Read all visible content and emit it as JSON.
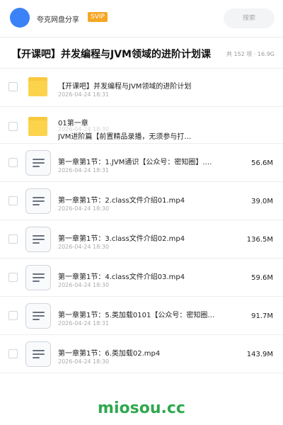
{
  "app": {
    "name": "夸克网盘分享",
    "badge": "SVIP",
    "search_placeholder": "搜索"
  },
  "header": {
    "title": "【开课吧】并发编程与JVM领域的进阶计划课",
    "meta": "共 152 项 · 16.9G"
  },
  "files": [
    {
      "type": "folder",
      "name": "【开课吧】并发编程与JVM领域的进阶计划",
      "date": "2026-04-24 18:31",
      "size": ""
    },
    {
      "type": "folder",
      "name": "01第一章",
      "date": "2026-04-24 18:30",
      "subtitle": "JVM进阶篇【前置精品录播，无须参与打…",
      "size": ""
    },
    {
      "type": "file",
      "name": "第一章第1节：1.JVM通识【公众号：密知圈】.…",
      "date": "2026-04-24 18:31",
      "size": "56.6M"
    },
    {
      "type": "file",
      "name": "第一章第1节：2.class文件介绍01.mp4",
      "date": "2026-04-24 18:30",
      "size": "39.0M"
    },
    {
      "type": "file",
      "name": "第一章第1节：3.class文件介绍02.mp4",
      "date": "2026-04-24 18:30",
      "size": "136.5M"
    },
    {
      "type": "file",
      "name": "第一章第1节：4.class文件介绍03.mp4",
      "date": "2026-04-24 18:30",
      "size": "59.6M"
    },
    {
      "type": "file",
      "name": "第一章第1节：5.类加载0101【公众号：密知圈…",
      "date": "2026-04-24 18:31",
      "size": "91.7M"
    },
    {
      "type": "file",
      "name": "第一章第1节：6.类加载02.mp4",
      "date": "2026-04-24 18:30",
      "size": "143.9M"
    }
  ],
  "watermark": "miosou.cc",
  "colors": {
    "accent": "#3b82f6",
    "svip": "#f5a623",
    "folder": "#fcd34d",
    "watermark": "#2fa84f"
  }
}
